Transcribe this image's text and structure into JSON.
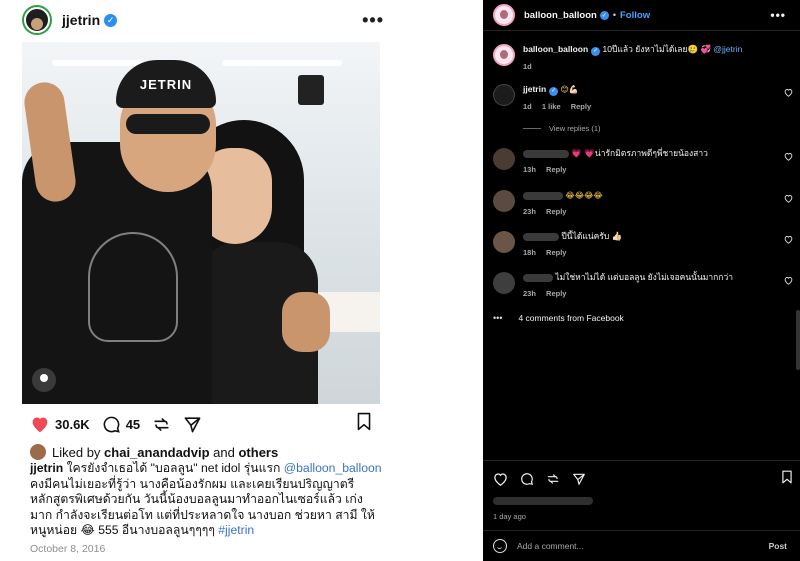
{
  "left_post": {
    "username": "jjetrin",
    "more_label": "•••",
    "cap_text": "JETRIN",
    "apple_glyph": "",
    "likes_count": "30.6K",
    "comments_count": "45",
    "liked_by_prefix": "Liked by",
    "liked_by_user": "chai_anandadvip",
    "liked_by_and": "and",
    "liked_by_others": "others",
    "caption_user": "jjetrin",
    "caption_part1": "ใครยังจำเธอได้ \"บอลลูน\" net idol รุ่นแรก",
    "caption_mention1": "@balloon_balloon",
    "caption_part2": "คงมีคนไม่เยอะที่รู้ว่า นางคือน้องรักผม และเคยเรียนปริญญาตรีหลักสูตรพิเศษด้วยกัน วันนี้น้องบอลลูนมาทำออกไนเซอร์แล้ว เก่งมาก กำลังจะเรียนต่อโท แต่ที่ประหลาดใจ นางบอก ช่วยหา สามี ให้หนูหน่อย 😂 555 อีนางบอลลูนๆๆๆๆ",
    "caption_hashtag": "#jjetrin",
    "date": "October 8, 2016"
  },
  "right_panel": {
    "header_username": "balloon_balloon",
    "header_dot": "•",
    "follow_label": "Follow",
    "more_label": "•••",
    "caption": {
      "username": "balloon_balloon",
      "text": "10ปีแล้ว ยังหาไม่ได้เลย🥲 💞",
      "mention": "@jjetrin",
      "age": "1d"
    },
    "reply": {
      "username": "jjetrin",
      "emojis": "😊💪🏻",
      "age": "1d",
      "likes": "1 like",
      "reply_label": "Reply"
    },
    "view_replies": "View replies (1)",
    "comments": [
      {
        "text": "💗 💗น่ารักมิตรภาพดีๆพี่ชายน้องสาว",
        "age": "13h",
        "reply_label": "Reply"
      },
      {
        "text": "😂😂😂😂",
        "age": "23h",
        "reply_label": "Reply"
      },
      {
        "text": "ปีนี้ได้แน่ครับ 👍🏻",
        "age": "18h",
        "reply_label": "Reply"
      },
      {
        "text": "ไม่ใช่หาไม่ได้ แต่บอลลูน ยังไม่เจอคนนั้นมากกว่า",
        "age": "23h",
        "reply_label": "Reply"
      }
    ],
    "fb_dots": "•••",
    "fb_comments": "4 comments from Facebook",
    "post_age": "1 day ago",
    "comment_placeholder": "Add a comment...",
    "post_label": "Post"
  },
  "colors": {
    "verified": "#2b8ff0",
    "follow": "#4aa3ff",
    "mention_light": "#3b72c5",
    "like_red": "#ed4956",
    "dark_bg": "#000000"
  },
  "icons": [
    "verified-icon",
    "heart-icon",
    "comment-icon",
    "share-icon",
    "send-icon",
    "bookmark-icon",
    "emoji-icon",
    "user-tag-icon"
  ]
}
